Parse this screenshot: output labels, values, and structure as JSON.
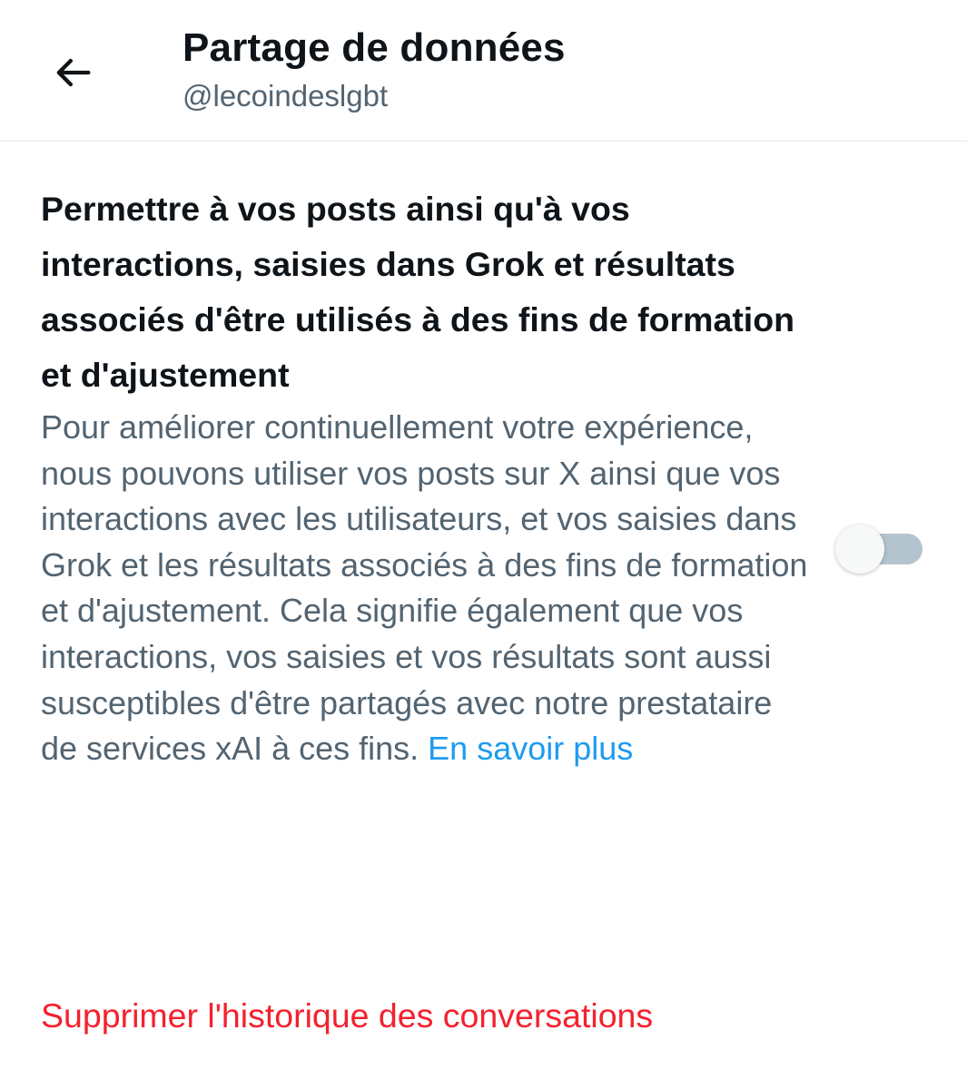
{
  "header": {
    "title": "Partage de données",
    "handle": "@lecoindeslgbt"
  },
  "setting": {
    "title": "Permettre à vos posts ainsi qu'à vos interactions, saisies dans Grok et résultats associés d'être utilisés à des fins de formation et d'ajustement",
    "description": "Pour améliorer continuellement votre expérience, nous pouvons utiliser vos posts sur X ainsi que vos interactions avec les utilisateurs, et vos saisies dans Grok et les résultats associés à des fins de formation et d'ajustement. Cela signifie également que vos interactions, vos saisies et vos résultats sont aussi susceptibles d'être partagés avec notre prestataire de services xAI à ces fins. ",
    "learn_more": "En savoir plus",
    "toggle_on": false
  },
  "actions": {
    "delete_history": "Supprimer l'historique des conversations"
  },
  "colors": {
    "primary_text": "#0f1419",
    "secondary_text": "#536471",
    "link": "#1d9bf0",
    "danger": "#f4212e",
    "toggle_track_off": "#b4c4ce"
  },
  "icons": {
    "back": "arrow-left-icon"
  }
}
